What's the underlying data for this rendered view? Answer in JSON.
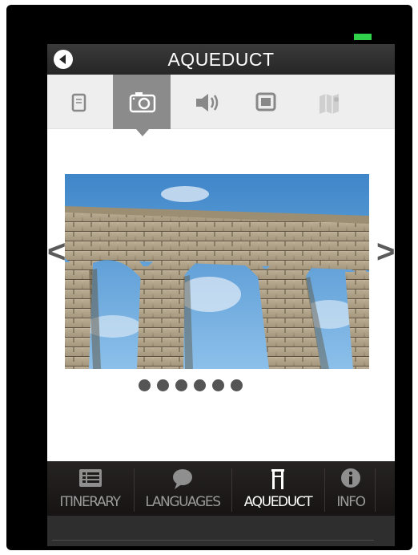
{
  "header": {
    "title": "AQUEDUCT",
    "back_icon": "back-arrow-icon"
  },
  "tabs": [
    {
      "icon": "document-icon",
      "active": false
    },
    {
      "icon": "camera-icon",
      "active": true
    },
    {
      "icon": "speaker-icon",
      "active": false
    },
    {
      "icon": "video-icon",
      "active": false
    },
    {
      "icon": "map-icon",
      "active": false
    }
  ],
  "gallery": {
    "prev_label": "<",
    "next_label": ">",
    "dots_count": 6
  },
  "bottom_nav": [
    {
      "label": "ITINERARY",
      "icon": "list-icon",
      "active": false
    },
    {
      "label": "LANGUAGES",
      "icon": "speech-bubble-icon",
      "active": false
    },
    {
      "label": "AQUEDUCT",
      "icon": "aqueduct-icon",
      "active": true
    },
    {
      "label": "INFO",
      "icon": "info-icon",
      "active": false
    }
  ],
  "colors": {
    "accent_active_tab": "#8b8b8b",
    "nav_active_text": "#ffffff",
    "nav_inactive_text": "#9a9a9a",
    "battery": "#2fd24a"
  }
}
